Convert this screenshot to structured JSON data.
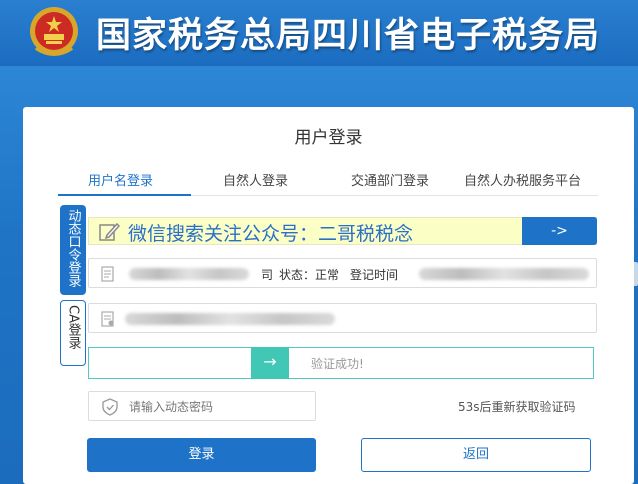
{
  "header": {
    "title": "国家税务总局四川省电子税务局",
    "emblem_icon": "national-emblem-icon"
  },
  "login": {
    "title": "用户登录",
    "tabs": [
      {
        "label": "用户名登录",
        "active": true
      },
      {
        "label": "自然人登录",
        "active": false
      },
      {
        "label": "交通部门登录",
        "active": false
      },
      {
        "label": "自然人办税服务平台",
        "active": false
      }
    ],
    "side_tabs": [
      {
        "label": "动态口令登录",
        "active": true
      },
      {
        "label": "CA登录",
        "active": false
      }
    ],
    "promo": {
      "text": "微信搜索关注公众号：二哥税税念",
      "button": "->",
      "icon": "edit-icon"
    },
    "info_field": {
      "company_suffix": "司",
      "status_label": "状态：正常",
      "register_label": "登记时间"
    },
    "slider": {
      "handle": "→",
      "text": "验证成功!"
    },
    "dynamic_password": {
      "placeholder": "请输入动态密码",
      "icon": "shield-icon"
    },
    "resend": "53s后重新获取验证码",
    "buttons": {
      "login": "登录",
      "back": "返回"
    }
  },
  "colors": {
    "brand_blue": "#1e73c8",
    "header_blue": "#1b6cc0",
    "promo_bg": "#fbffc6",
    "slider_teal": "#40c7b6"
  }
}
